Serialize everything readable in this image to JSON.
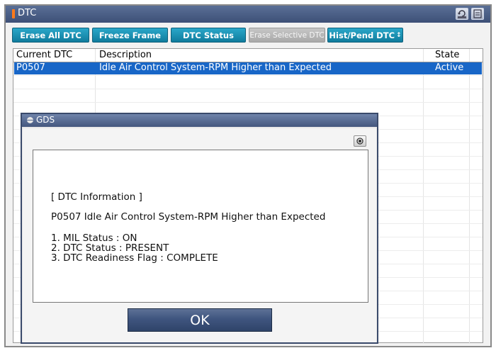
{
  "window": {
    "title": "DTC"
  },
  "toolbar": {
    "erase_all": "Erase All DTC",
    "freeze_frame": "Freeze Frame",
    "dtc_status": "DTC Status",
    "erase_selective": "Erase Selective DTC",
    "hist_pend": "Hist/Pend DTC",
    "hist_pend_arrow": "↕"
  },
  "table": {
    "columns": [
      "Current DTC",
      "Description",
      "State"
    ],
    "rows": [
      {
        "code": "P0507",
        "description": "Idle Air Control System-RPM Higher than Expected",
        "state": "Active"
      }
    ]
  },
  "dialog": {
    "title": "GDS",
    "heading": "[ DTC Information ]",
    "dtc_line": "P0507 Idle Air Control System-RPM Higher than Expected",
    "details": [
      "1. MIL Status : ON",
      "2. DTC Status : PRESENT",
      "3. DTC Readiness Flag : COMPLETE"
    ],
    "ok_label": "OK"
  },
  "colors": {
    "accent": "#1866c7",
    "button": "#1a8db0",
    "titlebar": "#44577e",
    "flag": "#ff7a1a"
  },
  "icons": [
    "retry-icon",
    "menu-icon",
    "camera-icon"
  ]
}
